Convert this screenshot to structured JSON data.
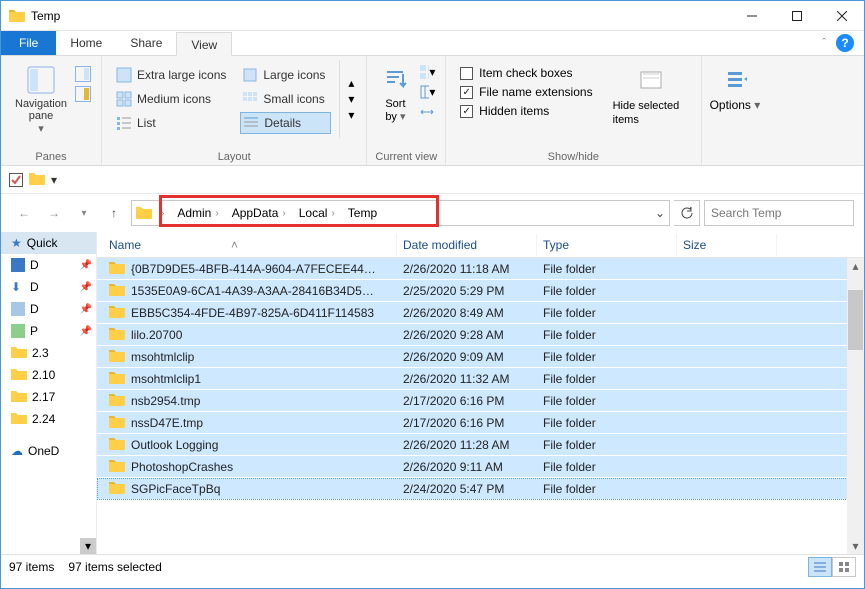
{
  "window": {
    "title": "Temp"
  },
  "tabs": {
    "file": "File",
    "home": "Home",
    "share": "Share",
    "view": "View"
  },
  "ribbon": {
    "panes": {
      "nav_label": "Navigation\npane",
      "group": "Panes"
    },
    "layout": {
      "extra_large": "Extra large icons",
      "large": "Large icons",
      "medium": "Medium icons",
      "small": "Small icons",
      "list": "List",
      "details": "Details",
      "group": "Layout"
    },
    "current": {
      "sort": "Sort\nby",
      "group": "Current view"
    },
    "showhide": {
      "itemcheck": "Item check boxes",
      "ext": "File name extensions",
      "hidden": "Hidden items",
      "hidesel": "Hide selected\nitems",
      "group": "Show/hide"
    },
    "options": {
      "label": "Options"
    }
  },
  "breadcrumb": [
    "Admin",
    "AppData",
    "Local",
    "Temp"
  ],
  "search": {
    "placeholder": "Search Temp"
  },
  "columns": {
    "name": "Name",
    "date": "Date modified",
    "type": "Type",
    "size": "Size"
  },
  "sidebar": {
    "quick": "Quick",
    "items": [
      {
        "icon": "desktop",
        "label": "D"
      },
      {
        "icon": "downloads",
        "label": "D"
      },
      {
        "icon": "documents",
        "label": "D"
      },
      {
        "icon": "pictures",
        "label": "P"
      },
      {
        "icon": "folder",
        "label": "2.3"
      },
      {
        "icon": "folder",
        "label": "2.10"
      },
      {
        "icon": "folder",
        "label": "2.17"
      },
      {
        "icon": "folder",
        "label": "2.24"
      }
    ],
    "onedrive": "OneD"
  },
  "rows": [
    {
      "name": "{0B7D9DE5-4BFB-414A-9604-A7FECEE44…",
      "date": "2/26/2020 11:18 AM",
      "type": "File folder"
    },
    {
      "name": "1535E0A9-6CA1-4A39-A3AA-28416B34D5…",
      "date": "2/25/2020 5:29 PM",
      "type": "File folder"
    },
    {
      "name": "EBB5C354-4FDE-4B97-825A-6D411F114583",
      "date": "2/26/2020 8:49 AM",
      "type": "File folder"
    },
    {
      "name": "lilo.20700",
      "date": "2/26/2020 9:28 AM",
      "type": "File folder"
    },
    {
      "name": "msohtmlclip",
      "date": "2/26/2020 9:09 AM",
      "type": "File folder"
    },
    {
      "name": "msohtmlclip1",
      "date": "2/26/2020 11:32 AM",
      "type": "File folder"
    },
    {
      "name": "nsb2954.tmp",
      "date": "2/17/2020 6:16 PM",
      "type": "File folder"
    },
    {
      "name": "nssD47E.tmp",
      "date": "2/17/2020 6:16 PM",
      "type": "File folder"
    },
    {
      "name": "Outlook Logging",
      "date": "2/26/2020 11:28 AM",
      "type": "File folder"
    },
    {
      "name": "PhotoshopCrashes",
      "date": "2/26/2020 9:11 AM",
      "type": "File folder"
    },
    {
      "name": "SGPicFaceTpBq",
      "date": "2/24/2020 5:47 PM",
      "type": "File folder"
    }
  ],
  "status": {
    "count": "97 items",
    "selected": "97 items selected"
  }
}
